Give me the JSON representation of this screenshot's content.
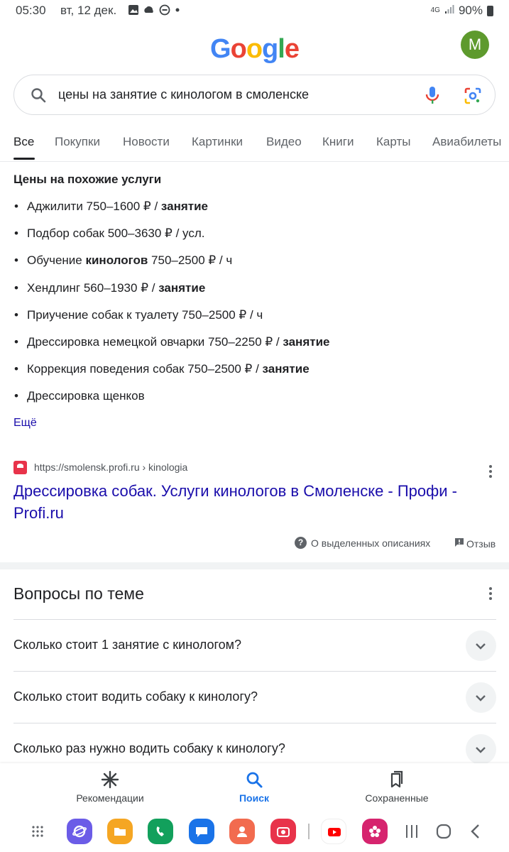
{
  "status_bar": {
    "time": "05:30",
    "date": "вт, 12 дек.",
    "network": "4G",
    "battery": "90%"
  },
  "header": {
    "logo_letters": [
      "G",
      "o",
      "o",
      "g",
      "l",
      "e"
    ],
    "logo_colors": [
      "#4285F4",
      "#EA4335",
      "#FBBC05",
      "#4285F4",
      "#34A853",
      "#EA4335"
    ],
    "avatar_letter": "M",
    "avatar_color": "#5e9a2d"
  },
  "search": {
    "query": "цены на занятие с кинологом в смоленске"
  },
  "tabs": [
    {
      "label": "Все",
      "active": true
    },
    {
      "label": "Покупки"
    },
    {
      "label": "Новости"
    },
    {
      "label": "Картинки"
    },
    {
      "label": "Видео"
    },
    {
      "label": "Книги"
    },
    {
      "label": "Карты"
    },
    {
      "label": "Авиабилеты"
    }
  ],
  "prices": {
    "title": "Цены на похожие услуги",
    "items": [
      {
        "pre": "Аджилити 750–1600 ₽ / ",
        "bold": "занятие",
        "post": ""
      },
      {
        "pre": "Подбор собак 500–3630 ₽ / усл.",
        "bold": "",
        "post": ""
      },
      {
        "pre": "Обучение ",
        "bold": "кинологов",
        "post": " 750–2500 ₽ / ч"
      },
      {
        "pre": "Хендлинг 560–1930 ₽ / ",
        "bold": "занятие",
        "post": ""
      },
      {
        "pre": "Приучение собак к туалету 750–2500 ₽ / ч",
        "bold": "",
        "post": ""
      },
      {
        "pre": "Дрессировка немецкой овчарки 750–2250 ₽ / ",
        "bold": "занятие",
        "post": ""
      },
      {
        "pre": "Коррекция поведения собак 750–2500 ₽ / ",
        "bold": "занятие",
        "post": ""
      },
      {
        "pre": "Дрессировка щенков",
        "bold": "",
        "post": ""
      }
    ],
    "more": "Ещё"
  },
  "result": {
    "url": "https://smolensk.profi.ru › kinologia",
    "title": "Дрессировка собак. Услуги кинологов в Смоленске - Профи - Profi.ru",
    "about": "О выделенных описаниях",
    "feedback": "Отзыв"
  },
  "questions": {
    "title": "Вопросы по теме",
    "items": [
      "Сколько стоит 1 занятие с кинологом?",
      "Сколько стоит водить собаку к кинологу?",
      "Сколько раз нужно водить собаку к кинологу?"
    ]
  },
  "bottom_nav": [
    {
      "label": "Рекомендации",
      "icon": "asterisk-icon"
    },
    {
      "label": "Поиск",
      "icon": "search-icon",
      "active": true
    },
    {
      "label": "Сохраненные",
      "icon": "bookmarks-icon"
    }
  ],
  "taskbar": {
    "apps": [
      {
        "name": "internet-app-icon",
        "color": "#6b5ce7"
      },
      {
        "name": "files-app-icon",
        "color": "#f5a623"
      },
      {
        "name": "phone-app-icon",
        "color": "#12a05c"
      },
      {
        "name": "messages-app-icon",
        "color": "#1a73e8"
      },
      {
        "name": "contacts-app-icon",
        "color": "#f26b4f"
      },
      {
        "name": "camera-app-icon",
        "color": "#e8334a"
      },
      {
        "name": "youtube-app-icon",
        "color": "#ff0000"
      },
      {
        "name": "gallery-app-icon",
        "color": "#d6246e"
      }
    ]
  }
}
